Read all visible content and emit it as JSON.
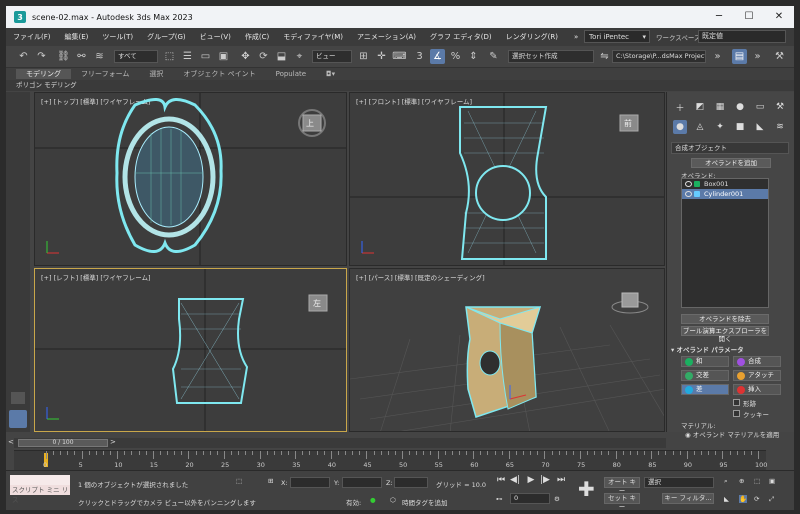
{
  "window": {
    "title": "scene-02.max - Autodesk 3ds Max 2023",
    "app_icon": "3ds-max-logo",
    "minimize_glyph": "─",
    "maximize_glyph": "☐",
    "close_glyph": "✕"
  },
  "menu": [
    "ファイル(F)",
    "編集(E)",
    "ツール(T)",
    "グループ(G)",
    "ビュー(V)",
    "作成(C)",
    "モディファイヤ(M)",
    "アニメーション(A)",
    "グラフ エディタ(D)",
    "レンダリング(R)"
  ],
  "menu_more": "»",
  "user": {
    "name": "Tori iPentec",
    "arrow": "▾"
  },
  "workspace": {
    "label": "ワークスペース:",
    "value": "既定値"
  },
  "toolbar": {
    "selection_filter": "すべて",
    "view_dropdown": "ビュー",
    "selection_set": "選択セット作成",
    "project_path": "C:\\Storage\\P...dsMax Project"
  },
  "ribbon": {
    "tabs": [
      "モデリング",
      "フリーフォーム",
      "選択",
      "オブジェクト ペイント",
      "Populate"
    ],
    "active_index": 0,
    "subtab": "ポリゴン モデリング"
  },
  "viewports": {
    "top": {
      "label": "[+] [トップ] [標準] [ワイヤフレーム]",
      "cube": "上"
    },
    "front": {
      "label": "[+] [フロント] [標準] [ワイヤフレーム]",
      "cube": "前"
    },
    "left": {
      "label": "[+] [レフト] [標準] [ワイヤフレーム]",
      "cube": "左"
    },
    "perspective": {
      "label": "[+] [パース] [標準] [既定のシェーディング]"
    }
  },
  "command_panel": {
    "category": "合成オブジェクト",
    "add_operand": "オペランドを追加",
    "operands_label": "オペランド:",
    "operands": [
      "Box001",
      "Cylinder001"
    ],
    "selected_operand": 1,
    "remove_operand": "オペランドを除去",
    "open_explorer": "ブール演算エクスプローラを開く",
    "params_title": "オペランド パラメータ",
    "ops": {
      "union": "和",
      "merge": "合成",
      "intersect": "交差",
      "attach": "アタッチ",
      "subtract": "差",
      "insert": "挿入"
    },
    "imprint": "形跡",
    "cookie": "クッキー",
    "material_label": "マテリアル:",
    "apply_operand_material": "オペランド マテリアルを適用"
  },
  "timeline": {
    "frame": "0 / 100",
    "ticks": [
      "0",
      "5",
      "10",
      "15",
      "20",
      "25",
      "30",
      "35",
      "40",
      "45",
      "50",
      "55",
      "60",
      "65",
      "70",
      "75",
      "80",
      "85",
      "90",
      "95",
      "100"
    ]
  },
  "status": {
    "script_label": "スクリプト ミニ リス",
    "message": "1 個のオブジェクトが選択されました",
    "hint": "クリックとドラッグでカメラ ビュー以外をパンニングします",
    "x_label": "X:",
    "y_label": "Y:",
    "z_label": "Z:",
    "grid": "グリッド = 10.0",
    "enabled": "有効:",
    "add_time_tag": "時間タグを追加",
    "frame_value": "0",
    "auto_key": "オート キー",
    "set_key": "セット キー",
    "selection": "選択",
    "key_filter": "キー フィルタ..."
  }
}
